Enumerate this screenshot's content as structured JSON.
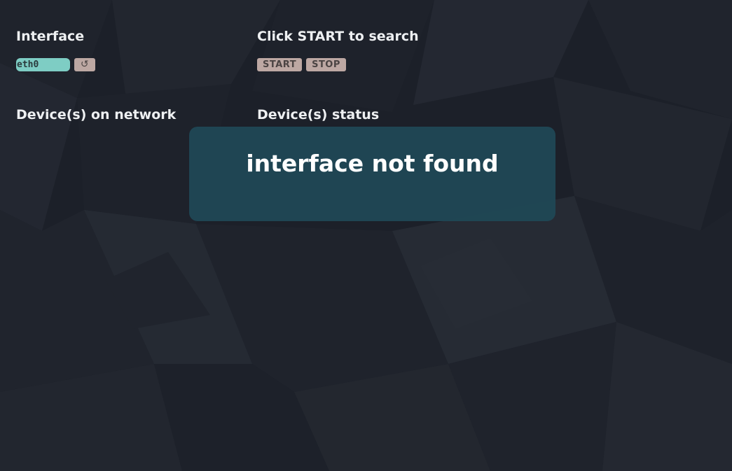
{
  "interface_panel": {
    "heading": "Interface",
    "input_value": "eth0",
    "refresh_label": "↺"
  },
  "search_panel": {
    "heading": "Click START to search",
    "start_label": "START",
    "stop_label": "STOP"
  },
  "devices_panel": {
    "heading": "Device(s) on network"
  },
  "status_panel": {
    "heading": "Device(s) status"
  },
  "alert": {
    "message": "interface not found"
  },
  "colors": {
    "background": "#1c2029",
    "input_bg": "#7ecdc4",
    "button_bg": "#bda8a3",
    "modal_bg": "#1f4856",
    "text": "#eef0f2"
  }
}
